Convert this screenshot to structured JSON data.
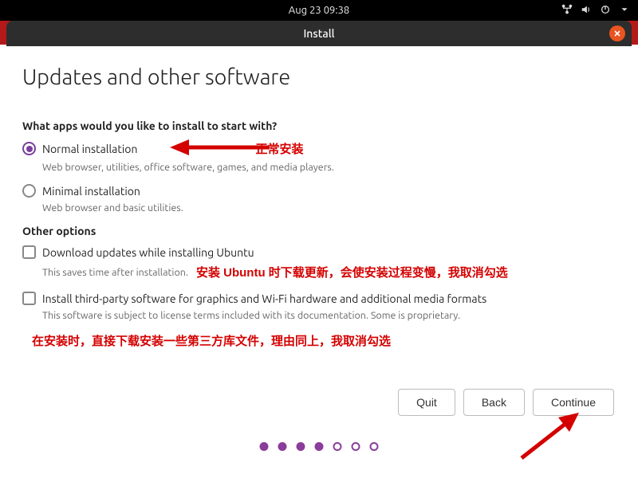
{
  "topbar": {
    "time": "Aug 23  09:38"
  },
  "titlebar": {
    "title": "Install"
  },
  "page": {
    "heading": "Updates and other software",
    "question": "What apps would you like to install to start with?",
    "opt_normal": "Normal installation",
    "opt_normal_desc": "Web browser, utilities, office software, games, and media players.",
    "opt_minimal": "Minimal installation",
    "opt_minimal_desc": "Web browser and basic utilities.",
    "other_options": "Other options",
    "chk_download": "Download updates while installing Ubuntu",
    "chk_download_desc": "This saves time after installation.",
    "chk_thirdparty": "Install third-party software for graphics and Wi-Fi hardware and additional media formats",
    "chk_thirdparty_desc": "This software is subject to license terms included with its documentation. Some is proprietary."
  },
  "annotations": {
    "normal": "正常安装",
    "download": "安装 Ubuntu 时下载更新，会使安装过程变慢，我取消勾选",
    "thirdparty": "在安装时，直接下载安装一些第三方库文件，理由同上，我取消勾选"
  },
  "buttons": {
    "quit": "Quit",
    "back": "Back",
    "continue": "Continue"
  },
  "progress": {
    "current": 4,
    "total": 7
  }
}
